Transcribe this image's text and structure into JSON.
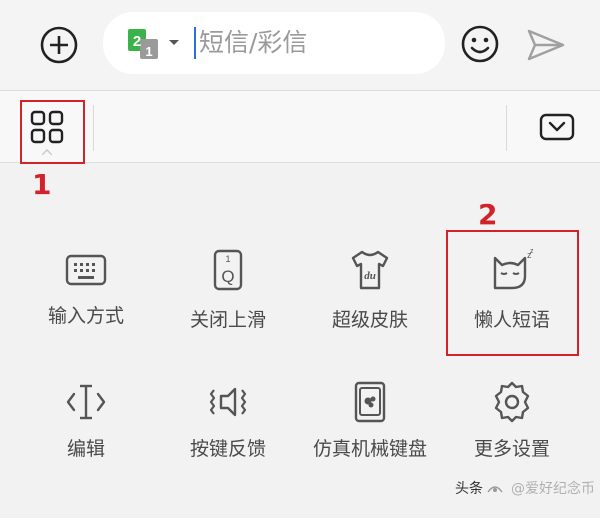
{
  "compose": {
    "sim_number": "2",
    "sim_sub": "1",
    "placeholder": "短信/彩信"
  },
  "highlights": [
    {
      "label": "1"
    },
    {
      "label": "2"
    }
  ],
  "panel": {
    "row1": [
      {
        "label": "输入方式",
        "icon": "keyboard-icon"
      },
      {
        "label": "关闭上滑",
        "icon": "swipe-key-icon"
      },
      {
        "label": "超级皮肤",
        "icon": "tshirt-icon"
      },
      {
        "label": "懒人短语",
        "icon": "sleeping-cat-icon"
      }
    ],
    "row2": [
      {
        "label": "编辑",
        "icon": "text-cursor-icon"
      },
      {
        "label": "按键反馈",
        "icon": "vibration-icon"
      },
      {
        "label": "仿真机械键盘",
        "icon": "mechanical-keyboard-icon"
      },
      {
        "label": "更多设置",
        "icon": "gear-icon"
      }
    ]
  },
  "watermark": {
    "brand": "头条",
    "account": "@爱好纪念币"
  },
  "colors": {
    "highlight": "#d2232a",
    "sim_green": "#3bb34a",
    "cursor": "#2a6ee0"
  }
}
